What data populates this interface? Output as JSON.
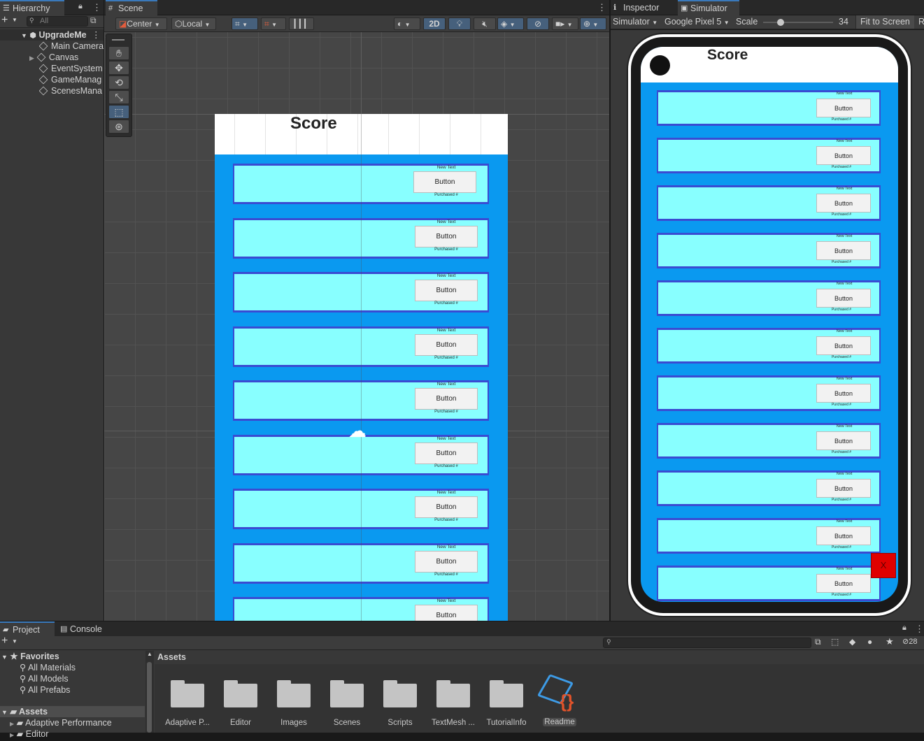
{
  "hierarchy": {
    "tab_label": "Hierarchy",
    "search_placeholder": "All",
    "scene_name": "UpgradeMe",
    "objects": [
      "Main Camera",
      "Canvas",
      "EventSystem",
      "GameManag",
      "ScenesMana"
    ]
  },
  "scene": {
    "tab_label": "Scene",
    "pivot_label": "Center",
    "space_label": "Local",
    "mode_2d": "2D",
    "canvas_title": "Score",
    "rows": [
      {
        "top_text": "New Text",
        "button": "Button",
        "bottom_text": "Purchased #"
      },
      {
        "top_text": "New Text",
        "button": "Button",
        "bottom_text": "Purchased #"
      },
      {
        "top_text": "New Text",
        "button": "Button",
        "bottom_text": "Purchased #"
      },
      {
        "top_text": "New Text",
        "button": "Button",
        "bottom_text": "Purchased #"
      },
      {
        "top_text": "New Text",
        "button": "Button",
        "bottom_text": "Purchased #"
      },
      {
        "top_text": "New Text",
        "button": "Button",
        "bottom_text": "Purchased #"
      },
      {
        "top_text": "New Text",
        "button": "Button",
        "bottom_text": "Purchased #"
      },
      {
        "top_text": "New Text",
        "button": "Button",
        "bottom_text": "Purchased #"
      },
      {
        "top_text": "New Text",
        "button": "Button",
        "bottom_text": ""
      }
    ]
  },
  "right_panel": {
    "tab_inspector": "Inspector",
    "tab_simulator": "Simulator",
    "mode_label": "Simulator",
    "device_label": "Google Pixel 5",
    "scale_label": "Scale",
    "scale_value": "34",
    "scale_fraction": 0.25,
    "fit_label": "Fit to Screen",
    "rotate_label": "R",
    "phone_title": "Score",
    "close_label": "X",
    "rows": [
      {
        "top_text": "New Text",
        "button": "Button",
        "bottom_text": "Purchased #"
      },
      {
        "top_text": "New Text",
        "button": "Button",
        "bottom_text": "Purchased #"
      },
      {
        "top_text": "New Text",
        "button": "Button",
        "bottom_text": "Purchased #"
      },
      {
        "top_text": "New Text",
        "button": "Button",
        "bottom_text": "Purchased #"
      },
      {
        "top_text": "New Text",
        "button": "Button",
        "bottom_text": "Purchased #"
      },
      {
        "top_text": "New Text",
        "button": "Button",
        "bottom_text": "Purchased #"
      },
      {
        "top_text": "New Text",
        "button": "Button",
        "bottom_text": "Purchased #"
      },
      {
        "top_text": "New Text",
        "button": "Button",
        "bottom_text": "Purchased #"
      },
      {
        "top_text": "New Text",
        "button": "Button",
        "bottom_text": "Purchased #"
      },
      {
        "top_text": "New Text",
        "button": "Button",
        "bottom_text": "Purchased #"
      },
      {
        "top_text": "New Text",
        "button": "Button",
        "bottom_text": "Purchased #"
      }
    ]
  },
  "bottom": {
    "tab_project": "Project",
    "tab_console": "Console",
    "hidden_count": "28",
    "favorites_label": "Favorites",
    "favorites": [
      "All Materials",
      "All Models",
      "All Prefabs"
    ],
    "assets_label": "Assets",
    "assets_tree": [
      "Adaptive Performance",
      "Editor"
    ],
    "breadcrumb": "Assets",
    "items": [
      {
        "name": "Adaptive P...",
        "type": "folder"
      },
      {
        "name": "Editor",
        "type": "folder"
      },
      {
        "name": "Images",
        "type": "folder"
      },
      {
        "name": "Scenes",
        "type": "folder"
      },
      {
        "name": "Scripts",
        "type": "folder"
      },
      {
        "name": "TextMesh ...",
        "type": "folder"
      },
      {
        "name": "TutorialInfo",
        "type": "folder"
      },
      {
        "name": "Readme",
        "type": "readme-asset"
      }
    ]
  },
  "colors": {
    "canvas_blue": "#0a99f0",
    "row_border": "#3a4bd2",
    "row_fill": "#88ffff",
    "close_red": "#e00000",
    "accent": "#3a79bb"
  }
}
